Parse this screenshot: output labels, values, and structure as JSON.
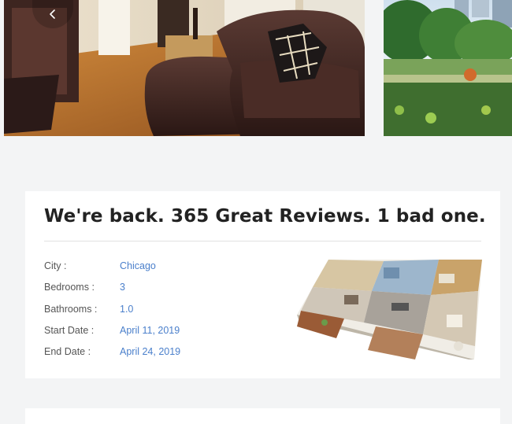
{
  "gallery": {
    "photos": [
      {
        "name": "living-room",
        "description": "Living room with leather couch"
      },
      {
        "name": "park",
        "description": "Park view"
      }
    ]
  },
  "listing": {
    "title": "We're back. 365 Great Reviews. 1 bad one.",
    "details": [
      {
        "label": "City :",
        "value": "Chicago"
      },
      {
        "label": "Bedrooms :",
        "value": "3"
      },
      {
        "label": "Bathrooms :",
        "value": "1.0"
      },
      {
        "label": "Start Date :",
        "value": "April 11, 2019"
      },
      {
        "label": "End Date :",
        "value": "April 24, 2019"
      }
    ]
  },
  "colors": {
    "page_bg": "#f3f4f5",
    "card_bg": "#ffffff",
    "title": "#222222",
    "label": "#555555",
    "link_value": "#4a7fcb"
  },
  "icons": {
    "prev": "chevron-left-icon"
  }
}
